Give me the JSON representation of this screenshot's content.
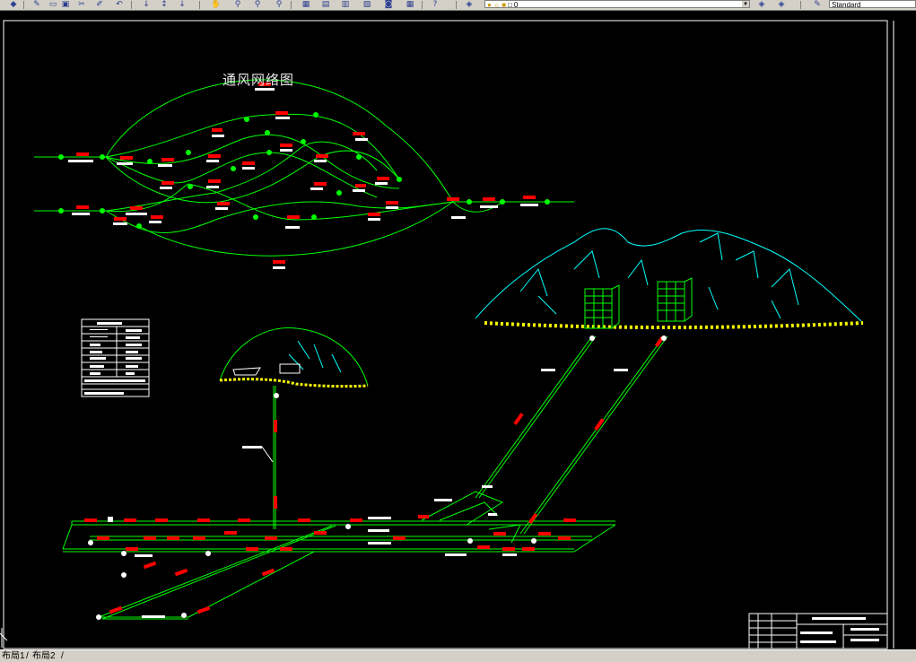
{
  "toolbar": {
    "icons": [
      "layer-icon",
      "plot-icon",
      "preview-icon",
      "save-icon",
      "cut-icon",
      "match-icon",
      "undo-icon",
      "redo-icon",
      "pan-icon",
      "zoom-realtime-icon",
      "zoom-window-icon",
      "zoom-previous-icon",
      "properties-icon",
      "design-center-icon",
      "tool-palette-icon",
      "sheet-set-icon",
      "markup-icon",
      "calculator-icon",
      "help-icon",
      "layer-manager-icon",
      "layer-state-icon",
      "linetype-icon",
      "style-icon"
    ],
    "layer_combo_value": "0",
    "style_combo_value": "Standard"
  },
  "drawing": {
    "title": "通风网络图",
    "colors": {
      "background": "#000000",
      "network_line": "#00ff00",
      "label_block": "#ff0000",
      "label_text": "#ffffff",
      "terrain": "#00ffff",
      "ground": "#ffff00",
      "frame": "#ffffff"
    }
  },
  "status": {
    "tabs": [
      "布局1",
      "布局2"
    ]
  }
}
